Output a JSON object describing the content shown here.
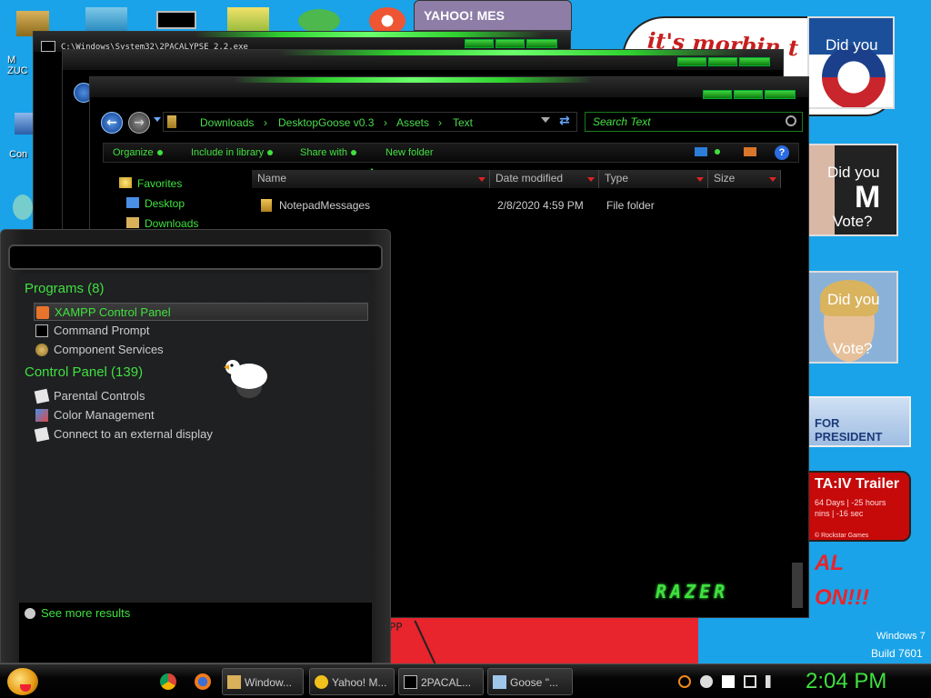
{
  "desktop": {
    "icons": [
      {
        "label": "M ZUC",
        "icon": "user-folder-icon"
      },
      {
        "label": "Con",
        "icon": "computer-icon"
      }
    ],
    "wallpaper": {
      "cloud_text": "it's morbin t",
      "ad_obama_text": "Did you",
      "ad_mccain_top": "Did you",
      "ad_mccain_big": "M",
      "ad_mccain_bottom": "Vote?",
      "ad_clinton_top": "Did you",
      "ad_clinton_bottom": "Vote?",
      "ad_president": "FOR PRESIDENT",
      "ad_gta_title": "TA:IV  Trailer",
      "ad_gta_line1": "64 Days | -25 hours",
      "ad_gta_line2": "nins | -16 sec",
      "ad_gta_credit": "© Rockstar Games",
      "text_al": "AL",
      "text_on": "ON!!!",
      "text_pp": "PP"
    },
    "watermark": {
      "line1": "Windows 7",
      "line2": "Build 7601"
    }
  },
  "windows": {
    "yahoo": {
      "title": "YAHOO! MES"
    },
    "cmd": {
      "title": "C:\\Windows\\System32\\2PACALYPSE 2.2.exe"
    },
    "explorer": {
      "breadcrumbs": [
        "Downloads",
        "DesktopGoose v0.3",
        "Assets",
        "Text"
      ],
      "breadcrumb_sep": "›",
      "search_placeholder": "Search Text",
      "commands": [
        "Organize",
        "Include in library",
        "Share with",
        "New folder"
      ],
      "help": "?",
      "nav": {
        "favorites": "Favorites",
        "items": [
          "Desktop",
          "Downloads"
        ]
      },
      "columns": [
        "Name",
        "Date modified",
        "Type",
        "Size"
      ],
      "rows": [
        {
          "name": "NotepadMessages",
          "date": "2/8/2020 4:59 PM",
          "type": "File folder",
          "size": ""
        }
      ],
      "brand": "RAZER"
    }
  },
  "start_menu": {
    "groups": [
      {
        "title": "Programs (8)",
        "items": [
          {
            "label": "XAMPP Control Panel",
            "icon": "xampp-icon",
            "selected": true
          },
          {
            "label": "Command Prompt",
            "icon": "cmd-icon"
          },
          {
            "label": "Component Services",
            "icon": "component-services-icon"
          }
        ]
      },
      {
        "title": "Control Panel (139)",
        "items": [
          {
            "label": "Parental Controls",
            "icon": "parental-controls-icon"
          },
          {
            "label": "Color Management",
            "icon": "color-management-icon"
          },
          {
            "label": "Connect to an external display",
            "icon": "external-display-icon"
          }
        ]
      }
    ],
    "see_more": "See more results"
  },
  "taskbar": {
    "pinned": [
      "chrome-icon",
      "firefox-icon"
    ],
    "tasks": [
      {
        "label": "Window...",
        "icon": "folder-icon"
      },
      {
        "label": "Yahoo! M...",
        "icon": "yahoo-messenger-icon"
      },
      {
        "label": "2PACAL...",
        "icon": "cmd-icon"
      },
      {
        "label": "Goose \"...",
        "icon": "notepad-icon"
      }
    ],
    "clock": "2:04 PM"
  },
  "colors": {
    "accent": "#3fe13f",
    "desktop": "#1aa3e8",
    "dark": "#000000"
  }
}
